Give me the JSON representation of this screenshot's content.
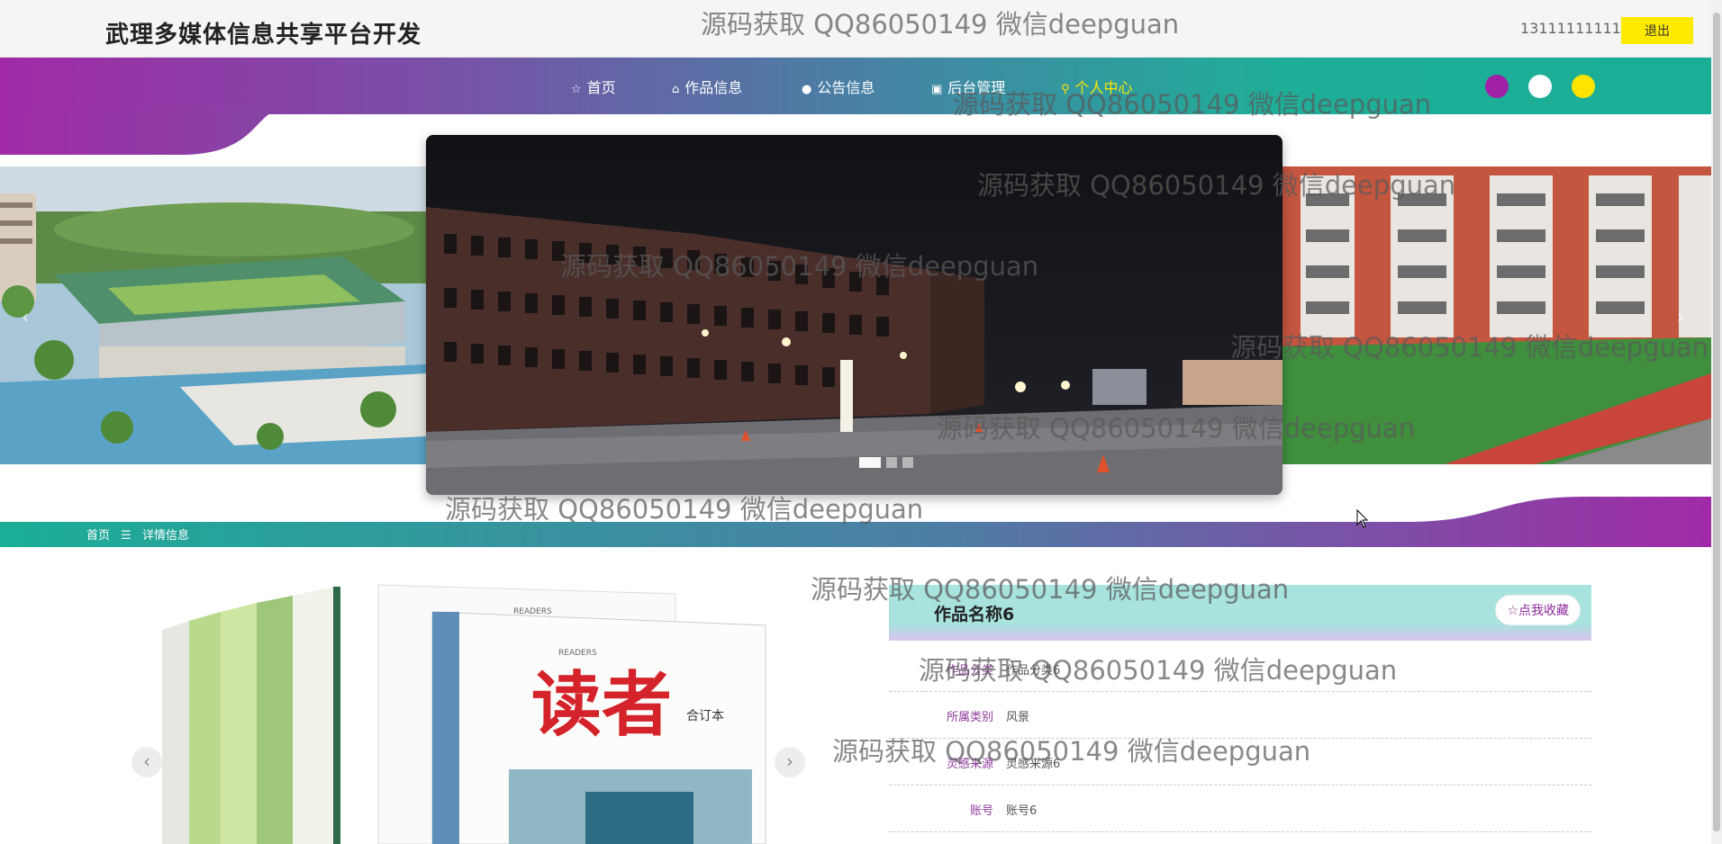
{
  "header": {
    "site_title": "武理多媒体信息共享平台开发",
    "user_account": "13111111111",
    "logout_label": "退出"
  },
  "nav": {
    "items": [
      {
        "label": "首页",
        "icon": "star-outline-icon",
        "glyph": "☆"
      },
      {
        "label": "作品信息",
        "icon": "home-icon",
        "glyph": "⌂"
      },
      {
        "label": "公告信息",
        "icon": "info-circle-icon",
        "glyph": "●"
      },
      {
        "label": "后台管理",
        "icon": "briefcase-icon",
        "glyph": "▣"
      },
      {
        "label": "个人中心",
        "icon": "user-icon",
        "glyph": "⚲"
      }
    ],
    "active_index": 4,
    "theme_colors": [
      "#a020a8",
      "#ffffff",
      "#ffe400"
    ]
  },
  "carousel": {
    "prev_glyph": "‹",
    "next_glyph": "›",
    "slide_count": 3,
    "active_slide": 0
  },
  "breadcrumb": {
    "home": "首页",
    "separator": "☰",
    "current": "详情信息"
  },
  "gallery": {
    "prev_glyph": "‹",
    "next_glyph": "›",
    "book_title": "读者",
    "book_subtitle": "合订本",
    "book_series": "READERS"
  },
  "detail": {
    "title": "作品名称6",
    "favorite_label": "☆点我收藏",
    "fields": [
      {
        "label": "作品分类",
        "value": "作品分类6"
      },
      {
        "label": "所属类别",
        "value": "风景"
      },
      {
        "label": "灵感来源",
        "value": "灵感来源6"
      },
      {
        "label": "账号",
        "value": "账号6"
      }
    ]
  },
  "watermark": "源码获取 QQ86050149 微信deepguan"
}
